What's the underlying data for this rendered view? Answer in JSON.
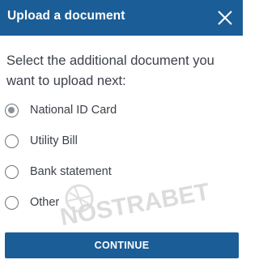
{
  "dialog": {
    "title": "Upload a document",
    "close_icon": "close-icon",
    "prompt": "Select the additional document you want to upload next:",
    "options": [
      {
        "label": "National ID Card",
        "selected": true
      },
      {
        "label": "Utility Bill",
        "selected": false
      },
      {
        "label": "Bank statement",
        "selected": false
      },
      {
        "label": "Other",
        "selected": false
      }
    ],
    "continue_label": "CONTINUE"
  },
  "watermark": {
    "text": "NOSTRABET"
  },
  "colors": {
    "header_bg": "#1b5d96",
    "button_bg": "#1b5d96",
    "text": "#3c4148",
    "radio_border": "#6e757c"
  }
}
